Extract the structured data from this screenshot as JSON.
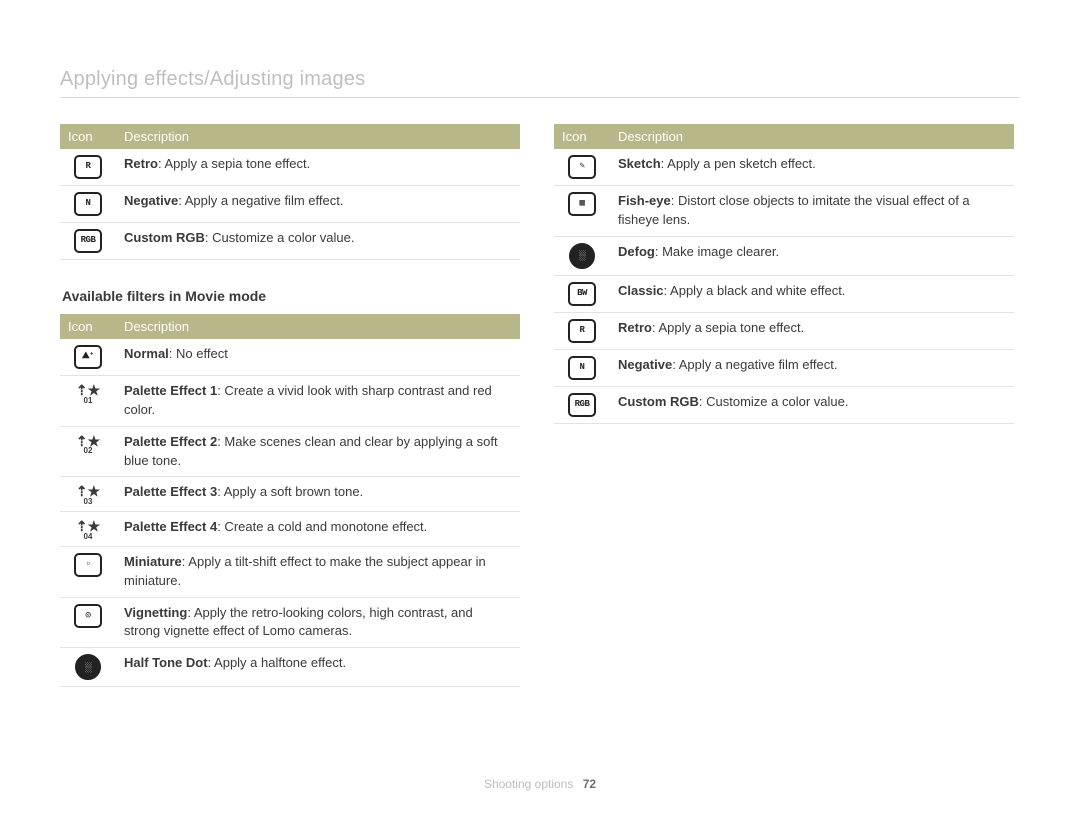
{
  "page_title": "Applying effects/Adjusting images",
  "th_icon": "Icon",
  "th_desc": "Description",
  "section_movie_title": "Available filters in Movie mode",
  "tbl1": [
    {
      "icon": "roundedrect",
      "glyph": "R",
      "b": "Retro",
      "t": ": Apply a sepia tone effect."
    },
    {
      "icon": "roundedrect",
      "glyph": "N",
      "b": "Negative",
      "t": ": Apply a negative film effect."
    },
    {
      "icon": "roundedrect",
      "glyph": "RGB",
      "b": "Custom RGB",
      "t": ": Customize a color value."
    }
  ],
  "tbl2": [
    {
      "icon": "roundedrect",
      "glyph": "⛰⁺",
      "b": "Normal",
      "t": ": No effect"
    },
    {
      "icon": "pe",
      "glyph": "01",
      "b": "Palette Effect 1",
      "t": ": Create a vivid look with sharp contrast and red color."
    },
    {
      "icon": "pe",
      "glyph": "02",
      "b": "Palette Effect 2",
      "t": ": Make scenes clean and clear by applying a soft blue tone."
    },
    {
      "icon": "pe",
      "glyph": "03",
      "b": "Palette Effect 3",
      "t": ": Apply a soft brown tone."
    },
    {
      "icon": "pe",
      "glyph": "04",
      "b": "Palette Effect 4",
      "t": ": Create a cold and monotone effect."
    },
    {
      "icon": "roundedrect",
      "glyph": "▫",
      "b": "Miniature",
      "t": ": Apply a tilt-shift effect to make the subject appear in miniature."
    },
    {
      "icon": "roundedrect",
      "glyph": "◎",
      "b": "Vignetting",
      "t": ": Apply the retro-looking colors, high contrast, and strong vignette effect of Lomo cameras."
    },
    {
      "icon": "solidround",
      "glyph": "░",
      "b": "Half Tone Dot",
      "t": ": Apply a halftone effect."
    }
  ],
  "tbl3": [
    {
      "icon": "roundedrect",
      "glyph": "✎",
      "b": "Sketch",
      "t": ": Apply a pen sketch effect."
    },
    {
      "icon": "roundedrect",
      "glyph": "▦",
      "b": "Fish-eye",
      "t": ": Distort close objects to imitate the visual effect of a fisheye lens."
    },
    {
      "icon": "solidround",
      "glyph": "░",
      "b": "Defog",
      "t": ": Make image clearer."
    },
    {
      "icon": "roundedrect",
      "glyph": "BW",
      "b": "Classic",
      "t": ": Apply a black and white effect."
    },
    {
      "icon": "roundedrect",
      "glyph": "R",
      "b": "Retro",
      "t": ": Apply a sepia tone effect."
    },
    {
      "icon": "roundedrect",
      "glyph": "N",
      "b": "Negative",
      "t": ": Apply a negative film effect."
    },
    {
      "icon": "roundedrect",
      "glyph": "RGB",
      "b": "Custom RGB",
      "t": ": Customize a color value."
    }
  ],
  "footer_label": "Shooting options",
  "footer_page": "72"
}
